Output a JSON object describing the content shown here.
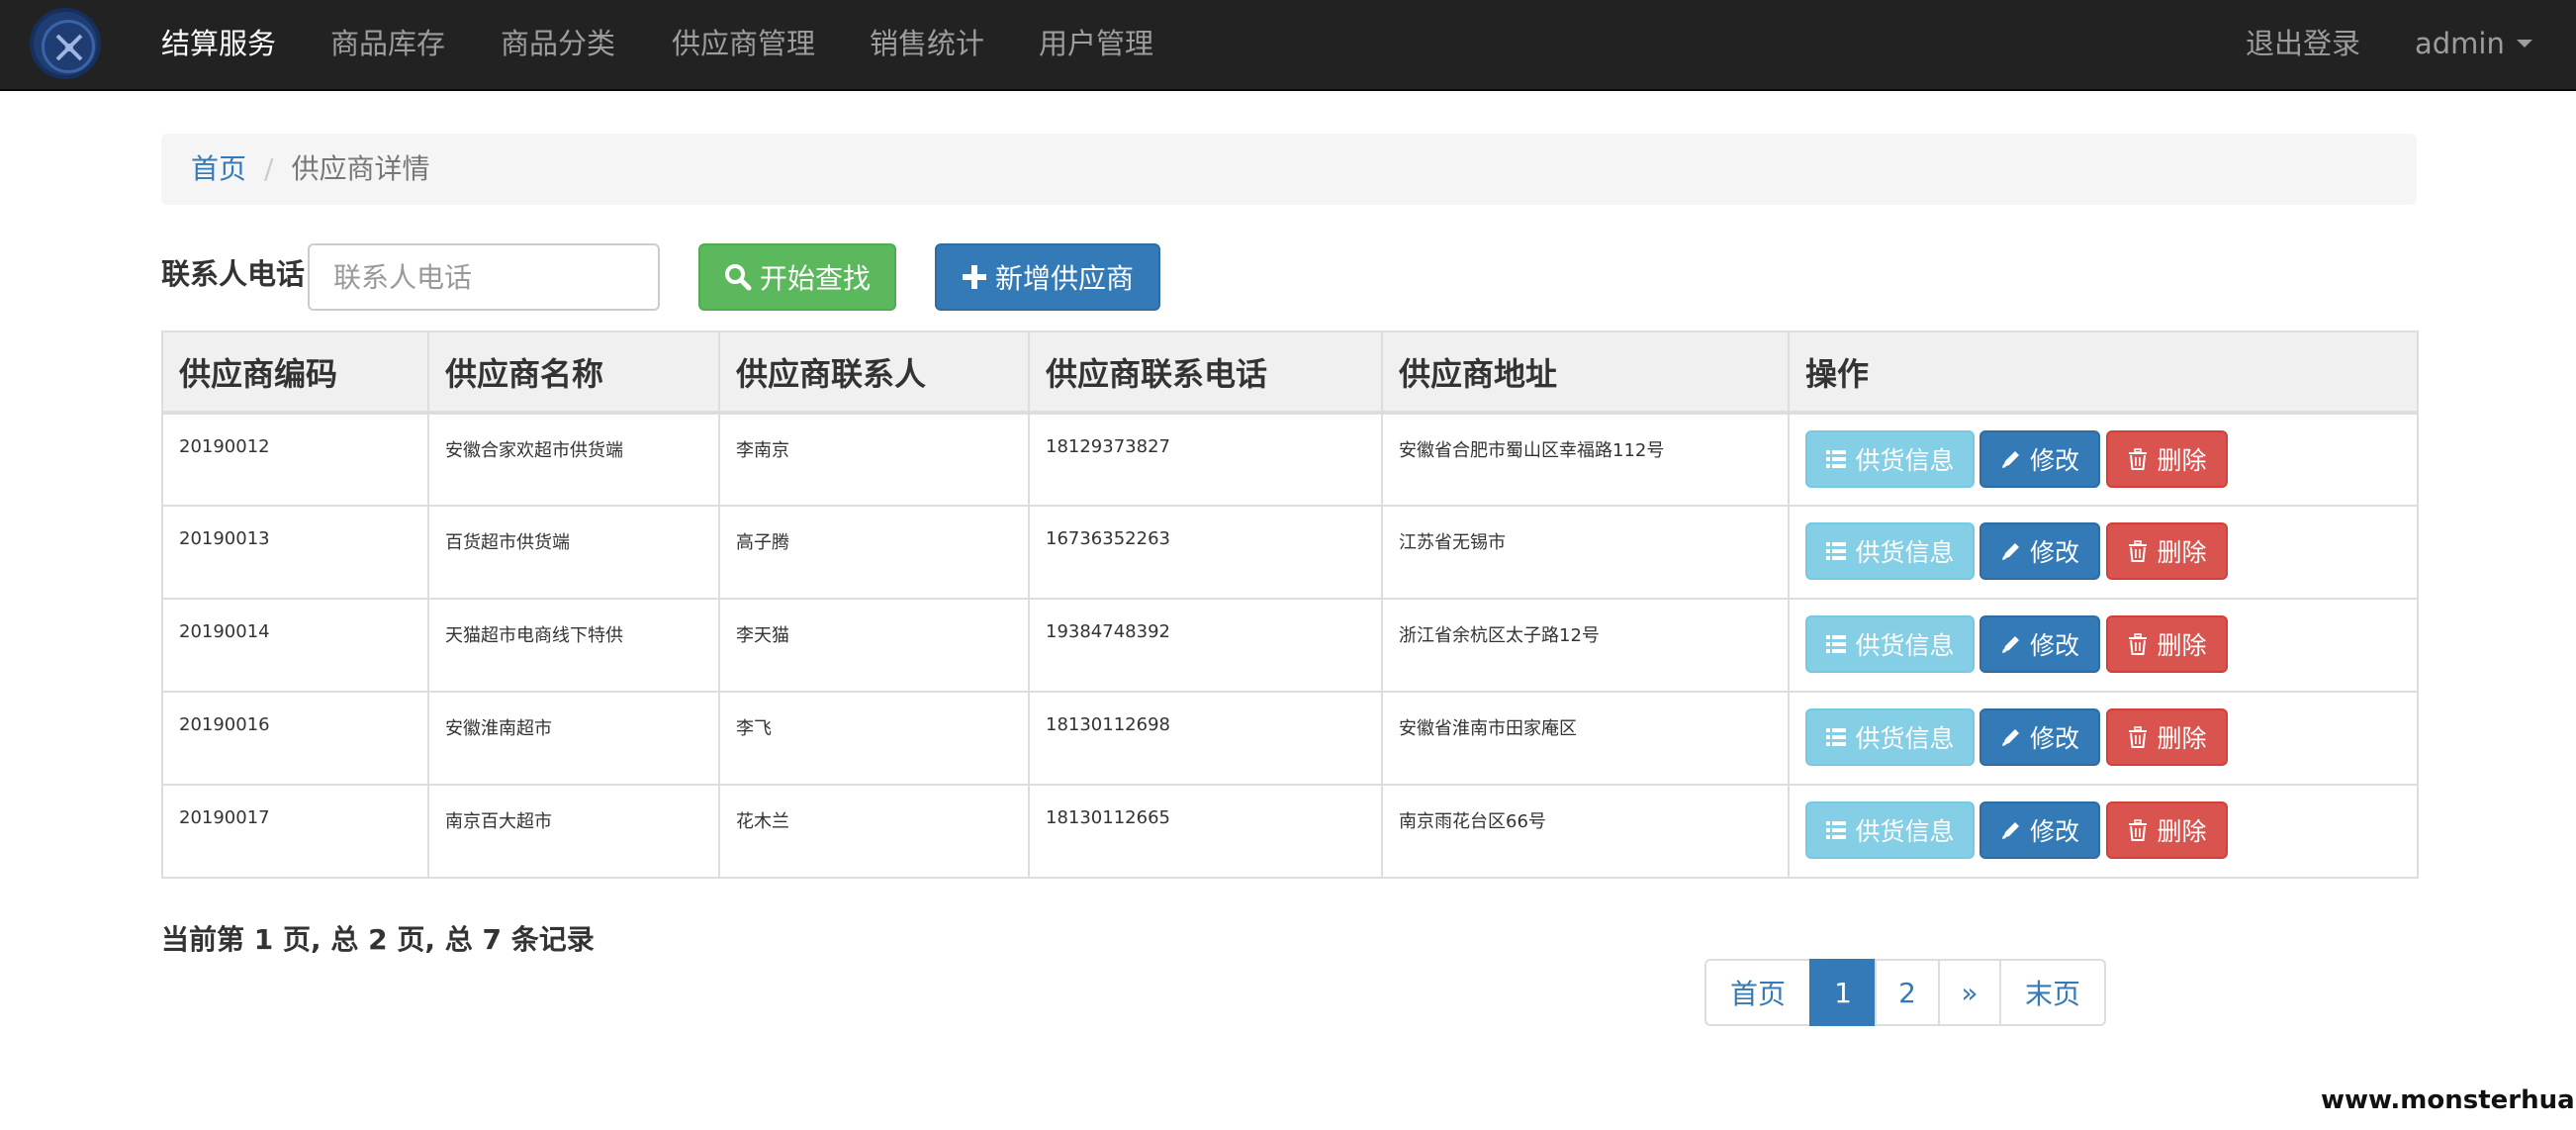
{
  "navbar": {
    "brand": "结算服务",
    "items": [
      "商品库存",
      "商品分类",
      "供应商管理",
      "销售统计",
      "用户管理"
    ],
    "logout": "退出登录",
    "user": "admin"
  },
  "breadcrumb": {
    "home": "首页",
    "separator": "/",
    "current": "供应商详情"
  },
  "search": {
    "label": "联系人电话",
    "placeholder": "联系人电话",
    "search_button": "开始查找",
    "add_button": "新增供应商"
  },
  "table": {
    "headers": [
      "供应商编码",
      "供应商名称",
      "供应商联系人",
      "供应商联系电话",
      "供应商地址",
      "操作"
    ],
    "rows": [
      [
        "20190012",
        "安徽合家欢超市供货端",
        "李南京",
        "18129373827",
        "安徽省合肥市蜀山区幸福路112号"
      ],
      [
        "20190013",
        "百货超市供货端",
        "高子腾",
        "16736352263",
        "江苏省无锡市"
      ],
      [
        "20190014",
        "天猫超市电商线下特供",
        "李天猫",
        "19384748392",
        "浙江省余杭区太子路12号"
      ],
      [
        "20190016",
        "安徽淮南超市",
        "李飞",
        "18130112698",
        "安徽省淮南市田家庵区"
      ],
      [
        "20190017",
        "南京百大超市",
        "花木兰",
        "18130112665",
        "南京雨花台区66号"
      ]
    ],
    "actions": {
      "info": "供货信息",
      "edit": "修改",
      "delete": "删除"
    }
  },
  "pagination": {
    "summary": "当前第 1 页, 总 2 页, 总 7 条记录",
    "first": "首页",
    "pages": [
      "1",
      "2"
    ],
    "current_page": "1",
    "next": "»",
    "last": "末页"
  },
  "watermark": "www.monsterhua.com",
  "colors": {
    "navbar_bg": "#222222",
    "success": "#5cb85c",
    "primary": "#337ab7",
    "info": "#5bc0de",
    "danger": "#d9534f"
  },
  "icons": {
    "search_button": "search-icon",
    "add_button": "plus-icon",
    "info": "list-icon",
    "edit": "pencil-icon",
    "delete": "trash-icon",
    "user_menu": "caret-down-icon",
    "logo": "tools-logo"
  }
}
